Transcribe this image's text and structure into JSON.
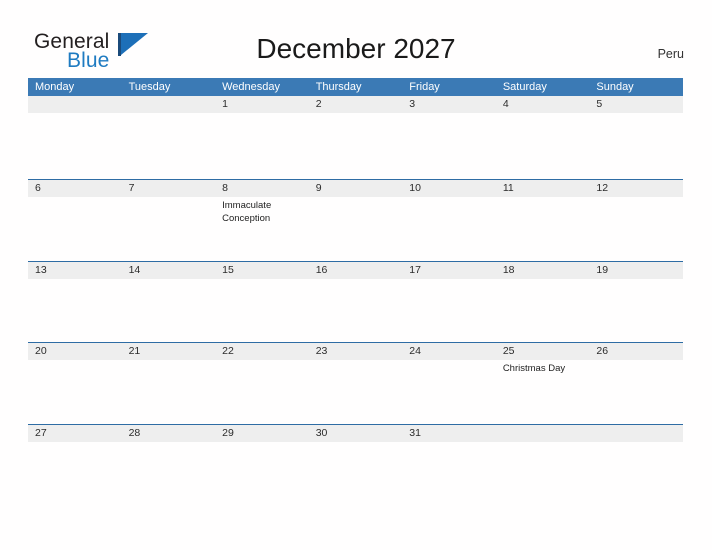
{
  "brand": {
    "name_part1": "General",
    "name_part2": "Blue",
    "flag_icon": "blue-flag-icon",
    "accent_color": "#1d6fb8"
  },
  "header": {
    "title": "December 2027",
    "country": "Peru"
  },
  "calendar": {
    "header_bg": "#3b7ab5",
    "date_strip_bg": "#eeeeee",
    "rule_color": "#2e6ca4",
    "weekday_headers": [
      "Monday",
      "Tuesday",
      "Wednesday",
      "Thursday",
      "Friday",
      "Saturday",
      "Sunday"
    ],
    "weeks": [
      {
        "cells": [
          {
            "date": "",
            "event": ""
          },
          {
            "date": "",
            "event": ""
          },
          {
            "date": "1",
            "event": ""
          },
          {
            "date": "2",
            "event": ""
          },
          {
            "date": "3",
            "event": ""
          },
          {
            "date": "4",
            "event": ""
          },
          {
            "date": "5",
            "event": ""
          }
        ]
      },
      {
        "cells": [
          {
            "date": "6",
            "event": ""
          },
          {
            "date": "7",
            "event": ""
          },
          {
            "date": "8",
            "event": "Immaculate Conception"
          },
          {
            "date": "9",
            "event": ""
          },
          {
            "date": "10",
            "event": ""
          },
          {
            "date": "11",
            "event": ""
          },
          {
            "date": "12",
            "event": ""
          }
        ]
      },
      {
        "cells": [
          {
            "date": "13",
            "event": ""
          },
          {
            "date": "14",
            "event": ""
          },
          {
            "date": "15",
            "event": ""
          },
          {
            "date": "16",
            "event": ""
          },
          {
            "date": "17",
            "event": ""
          },
          {
            "date": "18",
            "event": ""
          },
          {
            "date": "19",
            "event": ""
          }
        ]
      },
      {
        "cells": [
          {
            "date": "20",
            "event": ""
          },
          {
            "date": "21",
            "event": ""
          },
          {
            "date": "22",
            "event": ""
          },
          {
            "date": "23",
            "event": ""
          },
          {
            "date": "24",
            "event": ""
          },
          {
            "date": "25",
            "event": "Christmas Day"
          },
          {
            "date": "26",
            "event": ""
          }
        ]
      },
      {
        "cells": [
          {
            "date": "27",
            "event": ""
          },
          {
            "date": "28",
            "event": ""
          },
          {
            "date": "29",
            "event": ""
          },
          {
            "date": "30",
            "event": ""
          },
          {
            "date": "31",
            "event": ""
          },
          {
            "date": "",
            "event": ""
          },
          {
            "date": "",
            "event": ""
          }
        ]
      }
    ]
  }
}
